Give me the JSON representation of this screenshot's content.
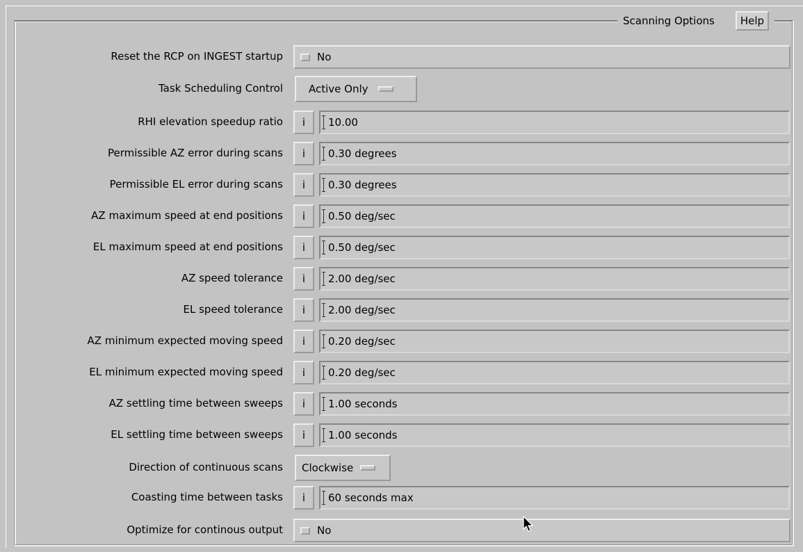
{
  "panel": {
    "title": "Scanning Options",
    "help_label": "Help"
  },
  "rows": [
    {
      "label": "Reset the RCP on INGEST startup",
      "type": "toggle",
      "value": "No"
    },
    {
      "label": "Task Scheduling Control",
      "type": "menu",
      "value": "Active Only"
    },
    {
      "label": "RHI elevation speedup ratio",
      "type": "field",
      "info": "i",
      "value": "10.00"
    },
    {
      "label": "Permissible AZ error during scans",
      "type": "field",
      "info": "i",
      "value": "0.30 degrees"
    },
    {
      "label": "Permissible EL error during scans",
      "type": "field",
      "info": "i",
      "value": "0.30 degrees"
    },
    {
      "label": "AZ maximum speed at end positions",
      "type": "field",
      "info": "i",
      "value": "0.50 deg/sec"
    },
    {
      "label": "EL maximum speed at end positions",
      "type": "field",
      "info": "i",
      "value": "0.50 deg/sec"
    },
    {
      "label": "AZ speed tolerance",
      "type": "field",
      "info": "i",
      "value": "2.00 deg/sec"
    },
    {
      "label": "EL speed tolerance",
      "type": "field",
      "info": "i",
      "value": "2.00 deg/sec"
    },
    {
      "label": "AZ minimum expected moving speed",
      "type": "field",
      "info": "i",
      "value": "0.20 deg/sec"
    },
    {
      "label": "EL minimum expected moving speed",
      "type": "field",
      "info": "i",
      "value": "0.20 deg/sec"
    },
    {
      "label": "AZ settling time between sweeps",
      "type": "field",
      "info": "i",
      "value": "1.00 seconds"
    },
    {
      "label": "EL settling time between sweeps",
      "type": "field",
      "info": "i",
      "value": "1.00 seconds"
    },
    {
      "label": "Direction of continuous scans",
      "type": "menu",
      "value": "Clockwise"
    },
    {
      "label": "Coasting time between tasks",
      "type": "field",
      "info": "i",
      "value": "60 seconds max"
    },
    {
      "label": "Optimize for continous output",
      "type": "toggle",
      "value": "No"
    }
  ],
  "icons": {
    "toggle": "toggle-indicator-icon",
    "menu": "option-menu-indicator-icon",
    "cursor": "mouse-pointer-icon"
  },
  "colors": {
    "background": "#c3c3c3",
    "widget": "#c8c8c8"
  }
}
